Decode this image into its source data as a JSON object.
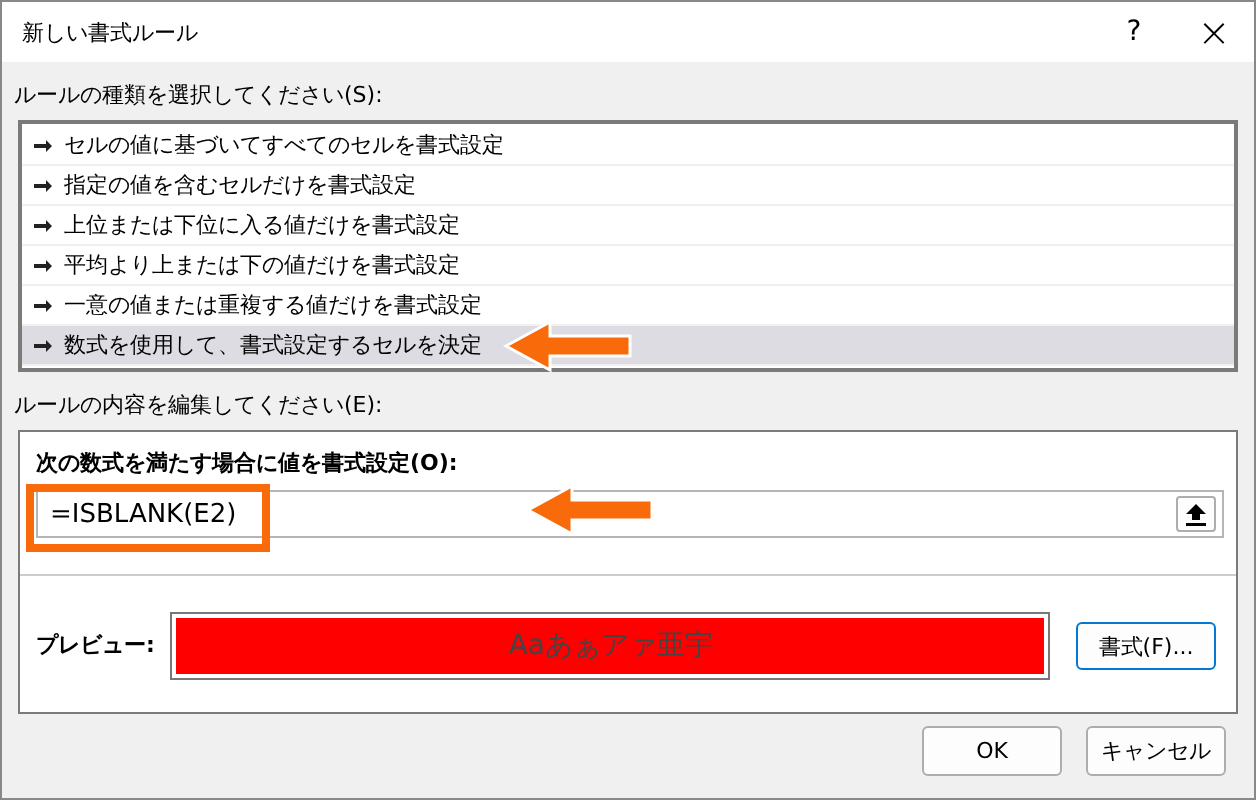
{
  "window": {
    "title": "新しい書式ルール",
    "help": "?",
    "close": "×"
  },
  "rule_type": {
    "label": "ルールの種類を選択してください(S):",
    "items": [
      {
        "text": "セルの値に基づいてすべてのセルを書式設定",
        "selected": false
      },
      {
        "text": "指定の値を含むセルだけを書式設定",
        "selected": false
      },
      {
        "text": "上位または下位に入る値だけを書式設定",
        "selected": false
      },
      {
        "text": "平均より上または下の値だけを書式設定",
        "selected": false
      },
      {
        "text": "一意の値または重複する値だけを書式設定",
        "selected": false
      },
      {
        "text": "数式を使用して、書式設定するセルを決定",
        "selected": true
      }
    ]
  },
  "rule_edit": {
    "label": "ルールの内容を編集してください(E):",
    "formula_label": "次の数式を満たす場合に値を書式設定(O):",
    "formula": "=ISBLANK(E2)",
    "preview_label": "プレビュー:",
    "preview_text": "Aaあぁアァ亜宇",
    "format_button": "書式(F)..."
  },
  "buttons": [
    "OK",
    "キャンセル"
  ]
}
